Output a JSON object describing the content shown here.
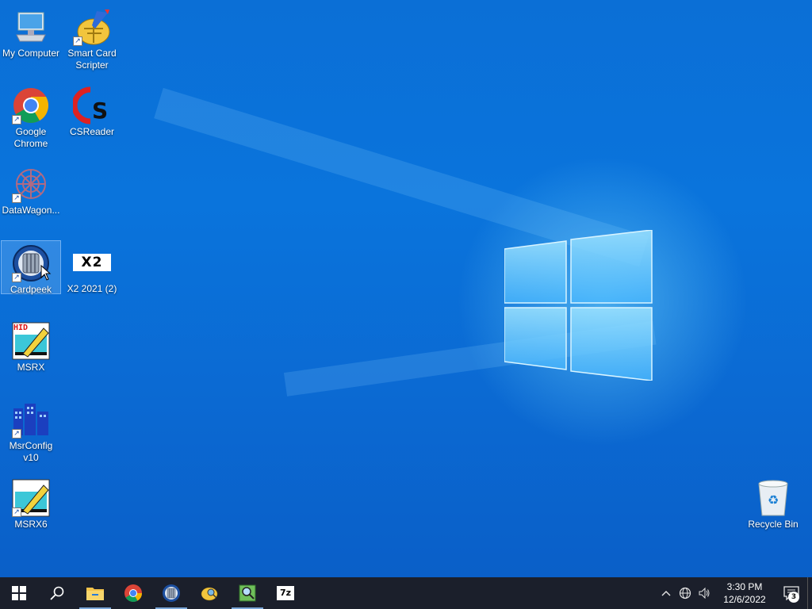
{
  "desktop": {
    "icons": [
      {
        "label": "My Computer",
        "icon": "computer-icon"
      },
      {
        "label": "Smart Card\nScripter",
        "icon": "smart-card-scripter-icon"
      },
      {
        "label": "Google\nChrome",
        "icon": "chrome-icon"
      },
      {
        "label": "CSReader",
        "icon": "csreader-icon"
      },
      {
        "label": "DataWagon...",
        "icon": "datawagon-icon"
      },
      {
        "label": "Cardpeek",
        "icon": "cardpeek-icon"
      },
      {
        "label": "X2 2021 (2)",
        "icon": "x2-icon"
      },
      {
        "label": "MSRX",
        "icon": "msrx-icon"
      },
      {
        "label": "MsrConfig\nv10",
        "icon": "msrconfig-icon"
      },
      {
        "label": "MSRX6",
        "icon": "msrx6-icon"
      },
      {
        "label": "Recycle Bin",
        "icon": "recycle-bin-icon"
      }
    ],
    "x2_badge": "X2",
    "hid_badge": "HID"
  },
  "taskbar": {
    "pinned": [
      {
        "name": "start-button",
        "icon": "windows-logo-icon"
      },
      {
        "name": "search-button",
        "icon": "search-icon"
      },
      {
        "name": "file-explorer-button",
        "icon": "folder-icon"
      },
      {
        "name": "chrome-button",
        "icon": "chrome-icon"
      },
      {
        "name": "cardpeek-button",
        "icon": "cardpeek-icon"
      },
      {
        "name": "smart-card-scripter-button",
        "icon": "smart-card-scripter-icon"
      },
      {
        "name": "image-viewer-button",
        "icon": "image-viewer-icon"
      },
      {
        "name": "7zip-button",
        "icon": "7zip-icon"
      }
    ],
    "sevenzip_label": "7z",
    "clock": {
      "time": "3:30 PM",
      "date": "12/6/2022"
    },
    "notification_count": "3"
  },
  "colors": {
    "taskbar_bg": "#1b1f2b",
    "desktop_accent": "#0a6fd3"
  }
}
